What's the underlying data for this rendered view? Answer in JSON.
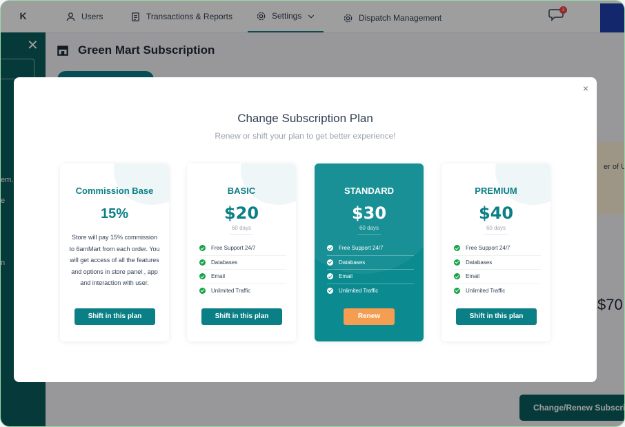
{
  "sidebar": {
    "collapse_icon": "K",
    "frag1": "em.",
    "frag2": "e",
    "frag3": "n"
  },
  "nav": [
    {
      "label": "Users",
      "icon": "user-icon"
    },
    {
      "label": "Transactions & Reports",
      "icon": "report-icon"
    },
    {
      "label": "Settings",
      "icon": "gear-icon"
    },
    {
      "label": "Dispatch Management",
      "icon": "gear-icon"
    }
  ],
  "chat_badge": "3",
  "page": {
    "title": "Green Mart Subscription",
    "side_text": "er of Use",
    "side_number": "$70",
    "change_renew": "Change/Renew Subscription"
  },
  "modal": {
    "close": "×",
    "title": "Change Subscription Plan",
    "subtitle": "Renew or shift your plan to get better experience!"
  },
  "plans": [
    {
      "name": "Commission Base",
      "price": "15%",
      "description": "Store will pay 15% commission to 6amMart from each order. You will get access of all the features and options  in store panel , app and interaction with user.",
      "button": "Shift in this plan"
    },
    {
      "name": "BASIC",
      "price": "$20",
      "days": "60 days",
      "features": [
        "Free Support 24/7",
        "Databases",
        "Email",
        "Unlimited Traffic"
      ],
      "button": "Shift in this plan"
    },
    {
      "name": "STANDARD",
      "price": "$30",
      "days": "60 days",
      "features": [
        "Free Support 24/7",
        "Databases",
        "Email",
        "Unlimited Traffic"
      ],
      "button": "Renew"
    },
    {
      "name": "PREMIUM",
      "price": "$40",
      "days": "60 days",
      "features": [
        "Free Support 24/7",
        "Databases",
        "Email",
        "Unlimited Traffic"
      ],
      "button": "Shift in this plan"
    }
  ],
  "colors": {
    "primary": "#0b7f86",
    "renew": "#f59e52",
    "sidebar": "#0b5e5e"
  }
}
